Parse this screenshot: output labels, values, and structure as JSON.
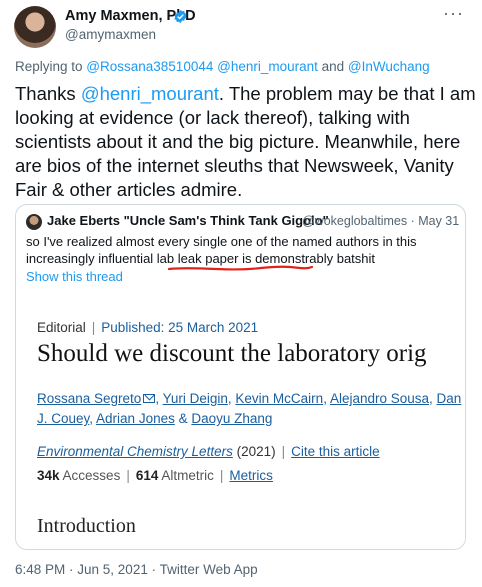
{
  "tweet": {
    "author": {
      "display_name": "Amy Maxmen, PhD",
      "handle": "@amymaxmen",
      "verified_icon": "verified-badge-icon"
    },
    "more_icon": "more-dots-icon",
    "replying": {
      "prefix": "Replying to ",
      "user1": "@Rossana38510044",
      "user2": "@henri_mourant",
      "and": " and ",
      "user3": "@InWuchang"
    },
    "text": {
      "part1": "Thanks ",
      "mention": "@henri_mourant",
      "part2": ". The problem may be that I am looking at evidence (or lack thereof), talking with scientists about it and the big picture. Meanwhile, here are bios of the internet sleuths that Newsweek, Vanity Fair & other articles admire."
    },
    "footer": "6:48 PM · Jun 5, 2021 · Twitter Web App"
  },
  "quote": {
    "name": "Jake Eberts \"Uncle Sam's Think Tank Gigolo\"",
    "meta": "@wokeglobaltimes · May 31",
    "text": "so I've realized almost every single one of the named authors in this increasingly influential lab leak paper is demonstrably batshit",
    "show_thread": "Show this thread",
    "annotation_color": "#e0241b"
  },
  "article": {
    "type": "Editorial",
    "published": "Published: 25 March 2021",
    "title": "Should we discount the laboratory orig",
    "authors": [
      "Rossana Segreto",
      "Yuri Deigin",
      "Kevin McCairn",
      "Alejandro Sousa",
      "Dan",
      "J. Couey",
      "Adrian Jones",
      "Daoyu Zhang"
    ],
    "journal": "Environmental Chemistry Letters",
    "year": "(2021)",
    "cite": "Cite this article",
    "accesses_value": "34k",
    "accesses_label": "Accesses",
    "altmetric_value": "614",
    "altmetric_label": "Altmetric",
    "metrics_link": "Metrics",
    "section": "Introduction"
  },
  "colors": {
    "twitter_blue": "#1d9bf0",
    "link_blue": "#1a5f9e",
    "secondary_text": "#536471"
  }
}
